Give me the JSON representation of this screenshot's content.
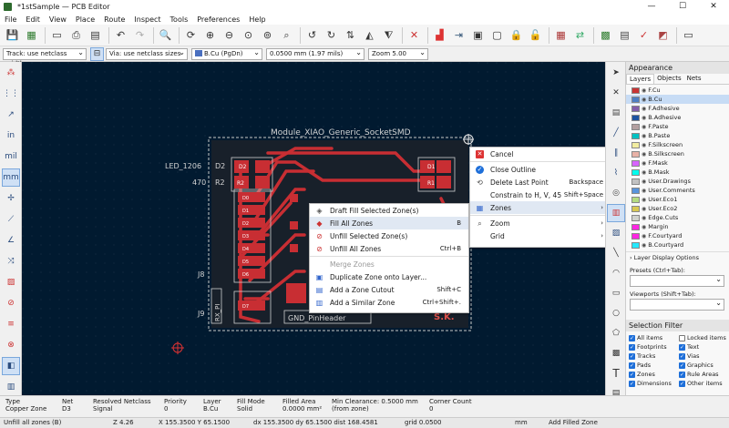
{
  "window": {
    "title": "*1stSample — PCB Editor",
    "minimize": "—",
    "maximize": "☐",
    "close": "✕"
  },
  "menubar": [
    "File",
    "Edit",
    "View",
    "Place",
    "Route",
    "Inspect",
    "Tools",
    "Preferences",
    "Help"
  ],
  "optbar": {
    "track": "Track: use netclass width",
    "via": "Via: use netclass sizes",
    "layer": "B.Cu (PgDn)",
    "grid": "0.0500 mm (1.97 mils)",
    "zoom": "Zoom 5.00"
  },
  "board": {
    "footprint_ref": "Module_XIAO_Generic_SocketSMD",
    "led_label": "LED_1206",
    "d2": "D2",
    "r470": "470",
    "r2": "R2",
    "j8": "J8",
    "j9": "J9",
    "rx_label": "RX_PI",
    "header_label": "GND_PinHeader",
    "sk_label": "S.K.",
    "d1": "D1",
    "r1": "R1",
    "d2b": "D2",
    "r2b": "R2",
    "pads_left": [
      "D0",
      "D1",
      "D2",
      "D3",
      "D4",
      "D5",
      "D6"
    ],
    "pads_right": [
      "D7",
      "D8"
    ],
    "pad_j9": "D7"
  },
  "context_menu": {
    "items": [
      {
        "icon": "cancel-icon",
        "label": "Cancel",
        "shortcut": ""
      },
      {
        "icon": "close-outline-icon",
        "label": "Close Outline",
        "shortcut": ""
      },
      {
        "icon": "delete-point-icon",
        "label": "Delete Last Point",
        "shortcut": "Backspace"
      },
      {
        "icon": "",
        "label": "Constrain to H, V, 45",
        "shortcut": "Shift+Space"
      },
      {
        "icon": "zones-icon",
        "label": "Zones",
        "shortcut": "›"
      },
      {
        "icon": "zoom-icon",
        "label": "Zoom",
        "shortcut": "›"
      },
      {
        "icon": "",
        "label": "Grid",
        "shortcut": "›"
      }
    ]
  },
  "zones_submenu": {
    "items": [
      {
        "label": "Draft Fill Selected Zone(s)",
        "shortcut": "",
        "disabled": false
      },
      {
        "label": "Fill All Zones",
        "shortcut": "B",
        "disabled": false
      },
      {
        "label": "Unfill Selected Zone(s)",
        "shortcut": "",
        "disabled": false
      },
      {
        "label": "Unfill All Zones",
        "shortcut": "Ctrl+B",
        "disabled": false
      },
      {
        "label": "Merge Zones",
        "shortcut": "",
        "disabled": true
      },
      {
        "label": "Duplicate Zone onto Layer...",
        "shortcut": "",
        "disabled": false
      },
      {
        "label": "Add a Zone Cutout",
        "shortcut": "Shift+C",
        "disabled": false
      },
      {
        "label": "Add a Similar Zone",
        "shortcut": "Ctrl+Shift+.",
        "disabled": false
      }
    ]
  },
  "appearance": {
    "title": "Appearance",
    "tabs": [
      "Layers",
      "Objects",
      "Nets"
    ],
    "layers": [
      {
        "name": "F.Cu",
        "color": "#c83434"
      },
      {
        "name": "B.Cu",
        "color": "#4d7fc4"
      },
      {
        "name": "F.Adhesive",
        "color": "#845eab"
      },
      {
        "name": "B.Adhesive",
        "color": "#1d53a1"
      },
      {
        "name": "F.Paste",
        "color": "#b4a0a0"
      },
      {
        "name": "B.Paste",
        "color": "#00c2c2"
      },
      {
        "name": "F.Silkscreen",
        "color": "#f2eda1"
      },
      {
        "name": "B.Silkscreen",
        "color": "#e8b2a7"
      },
      {
        "name": "F.Mask",
        "color": "#d864ff"
      },
      {
        "name": "B.Mask",
        "color": "#02ffee"
      },
      {
        "name": "User.Drawings",
        "color": "#c2c2c2"
      },
      {
        "name": "User.Comments",
        "color": "#5994dc"
      },
      {
        "name": "User.Eco1",
        "color": "#b4db80"
      },
      {
        "name": "User.Eco2",
        "color": "#d8c852"
      },
      {
        "name": "Edge.Cuts",
        "color": "#d0d2cd"
      },
      {
        "name": "Margin",
        "color": "#ff26e2"
      },
      {
        "name": "F.Courtyard",
        "color": "#ff26e2"
      },
      {
        "name": "B.Courtyard",
        "color": "#26e9ff"
      }
    ],
    "layer_display_options": "Layer Display Options",
    "presets_label": "Presets (Ctrl+Tab):",
    "presets_value": "",
    "viewports_label": "Viewports (Shift+Tab):",
    "viewports_value": ""
  },
  "selection_filter": {
    "title": "Selection Filter",
    "items": [
      {
        "label": "All items",
        "checked": true
      },
      {
        "label": "Locked items",
        "checked": false
      },
      {
        "label": "Footprints",
        "checked": true
      },
      {
        "label": "Text",
        "checked": true
      },
      {
        "label": "Tracks",
        "checked": true
      },
      {
        "label": "Vias",
        "checked": true
      },
      {
        "label": "Pads",
        "checked": true
      },
      {
        "label": "Graphics",
        "checked": true
      },
      {
        "label": "Zones",
        "checked": true
      },
      {
        "label": "Rule Areas",
        "checked": true
      },
      {
        "label": "Dimensions",
        "checked": true
      },
      {
        "label": "Other items",
        "checked": true
      }
    ]
  },
  "msgpanel": [
    {
      "h": "Type",
      "v": "Copper Zone"
    },
    {
      "h": "Net",
      "v": "D3"
    },
    {
      "h": "Resolved Netclass",
      "v": "Signal"
    },
    {
      "h": "Priority",
      "v": "0"
    },
    {
      "h": "Layer",
      "v": "B.Cu"
    },
    {
      "h": "Fill Mode",
      "v": "Solid"
    },
    {
      "h": "Filled Area",
      "v": "0.0000 mm²"
    },
    {
      "h": "Min Clearance: 0.5000 mm",
      "v": "(from zone)"
    },
    {
      "h": "Corner Count",
      "v": "0"
    }
  ],
  "statusbar": {
    "message": "Unfill all zones (B)",
    "zoom": "Z 4.26",
    "xy": "X 155.3500  Y 65.1500",
    "dxdy": "dx 155.3500  dy 65.1500  dist 168.4581",
    "grid": "grid 0.0500",
    "units": "mm",
    "mode": "Add Filled Zone"
  }
}
